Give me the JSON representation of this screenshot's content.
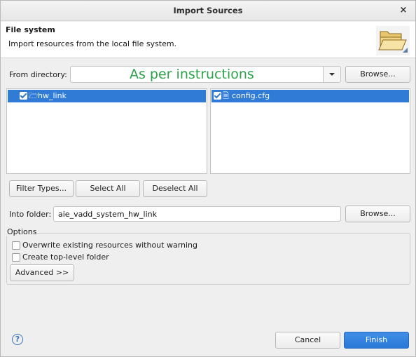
{
  "dialog": {
    "title": "Import Sources",
    "close_symbol": "×"
  },
  "banner": {
    "title": "File system",
    "description": "Import resources from the local file system.",
    "icon": "open-folder-icon"
  },
  "source": {
    "label": "From directory:",
    "value": "As per instructions",
    "browse_label": "Browse..."
  },
  "folders_pane": {
    "items": [
      {
        "label": "hw_link",
        "checked": true,
        "icon": "folder-icon",
        "selected": true
      }
    ]
  },
  "files_pane": {
    "items": [
      {
        "label": "config.cfg",
        "checked": true,
        "icon": "file-icon",
        "selected": true
      }
    ]
  },
  "selection_buttons": {
    "filter_types": "Filter Types...",
    "select_all": "Select All",
    "deselect_all": "Deselect All"
  },
  "destination": {
    "label": "Into folder:",
    "value": "aie_vadd_system_hw_link",
    "browse_label": "Browse..."
  },
  "options": {
    "legend": "Options",
    "overwrite_label": "Overwrite existing resources without warning",
    "overwrite_checked": false,
    "create_top_level_label": "Create top-level folder",
    "create_top_level_checked": false,
    "advanced_label": "Advanced >>"
  },
  "footer": {
    "help_symbol": "?",
    "cancel_label": "Cancel",
    "finish_label": "Finish"
  },
  "colors": {
    "selection": "#2f7bd6",
    "primary_button": "#2a77d8",
    "instruction_text": "#2ca24a"
  }
}
